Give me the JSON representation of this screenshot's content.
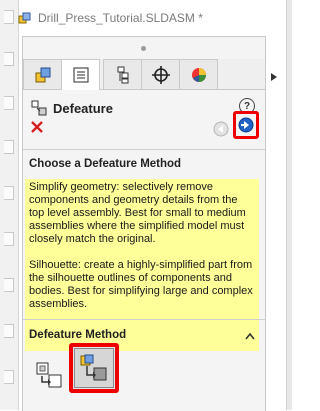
{
  "tree": {
    "document_title": "Drill_Press_Tutorial.SLDASM *",
    "icon": "assembly-icon"
  },
  "tabs": [
    {
      "name": "feature-manager-tab",
      "icon": "feature-tree-icon"
    },
    {
      "name": "property-manager-tab",
      "icon": "property-list-icon",
      "active": true
    },
    {
      "name": "configuration-manager-tab",
      "icon": "configuration-icon"
    },
    {
      "name": "dimxpert-tab",
      "icon": "crosshair-icon"
    },
    {
      "name": "display-manager-tab",
      "icon": "appearance-pie-icon"
    }
  ],
  "property_manager": {
    "title": "Defeature",
    "help_glyph": "?",
    "actions": {
      "close": "close-icon",
      "back": "back-arrow-icon",
      "next": "next-arrow-icon"
    }
  },
  "choose_method": {
    "heading": "Choose a Defeature Method",
    "info_text_1": "Simplify geometry: selectively remove components and geometry details from the top level assembly. Best for small to medium assemblies where the simplified model must closely match the original.",
    "info_text_2": "Silhouette: create a highly-simplified part from the silhouette outlines of components and bodies. Best for simplifying large and complex assemblies."
  },
  "defeature_method": {
    "heading": "Defeature Method",
    "options": [
      {
        "name": "simplify-geometry-option",
        "icon": "simplify-geometry-icon"
      },
      {
        "name": "silhouette-option",
        "icon": "silhouette-icon",
        "selected": true
      }
    ]
  },
  "colors": {
    "highlight_border": "#ee0000",
    "info_background": "#ffff99",
    "next_arrow": "#1f63c6",
    "close_x": "#d42020"
  }
}
